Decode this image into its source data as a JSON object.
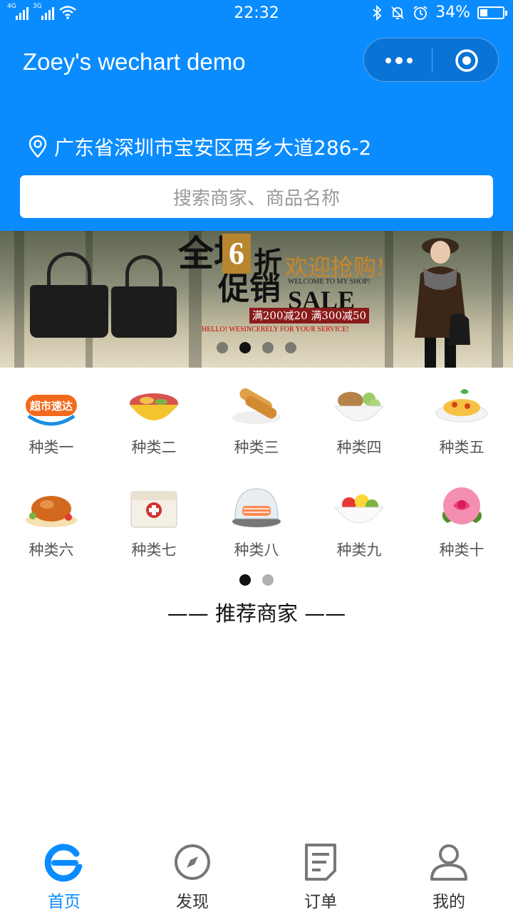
{
  "status_bar": {
    "net1": "4G",
    "net2": "3G",
    "time": "22:32",
    "battery": "34%",
    "battery_level": 0.34
  },
  "title_bar": {
    "title": "Zoey's wechart demo"
  },
  "location": {
    "address": "广东省深圳市宝安区西乡大道286-2"
  },
  "search": {
    "placeholder": "搜索商家、商品名称"
  },
  "banner": {
    "quan_chang": "全场",
    "cu_xiao": "促销",
    "six": "6",
    "zhe": "折",
    "welcome_cn": "欢迎抢购!",
    "welcome_en": "WELCOME TO MY SHOP!",
    "sale": "SALE",
    "deal": "满200减20  满300减50",
    "service": "HELLO!  WESINCERELY FOR YOUR SERVICE!",
    "active_dot": 1,
    "dot_count": 4
  },
  "categories": [
    {
      "label": "种类一",
      "icon": "supermarket-express-icon"
    },
    {
      "label": "种类二",
      "icon": "rice-bowl-icon"
    },
    {
      "label": "种类三",
      "icon": "spring-roll-icon"
    },
    {
      "label": "种类四",
      "icon": "meat-bowl-icon"
    },
    {
      "label": "种类五",
      "icon": "pasta-icon"
    },
    {
      "label": "种类六",
      "icon": "roast-chicken-icon"
    },
    {
      "label": "种类七",
      "icon": "first-aid-kit-icon"
    },
    {
      "label": "种类八",
      "icon": "salmon-dish-icon"
    },
    {
      "label": "种类九",
      "icon": "fruit-bowl-icon"
    },
    {
      "label": "种类十",
      "icon": "rose-icon"
    }
  ],
  "category_pager": {
    "active_dot": 0,
    "dot_count": 2
  },
  "supermarket_badge": "超市速达",
  "section": {
    "title": "—— 推荐商家 ——"
  },
  "tabbar": [
    {
      "label": "首页",
      "icon": "home-e-icon",
      "active": true
    },
    {
      "label": "发现",
      "icon": "compass-icon",
      "active": false
    },
    {
      "label": "订单",
      "icon": "order-list-icon",
      "active": false
    },
    {
      "label": "我的",
      "icon": "user-icon",
      "active": false
    }
  ],
  "colors": {
    "primary": "#0a8cff",
    "capsule": "#0a73d6",
    "dot_active": "#111111",
    "dot_inactive": "#b0b0b0"
  }
}
